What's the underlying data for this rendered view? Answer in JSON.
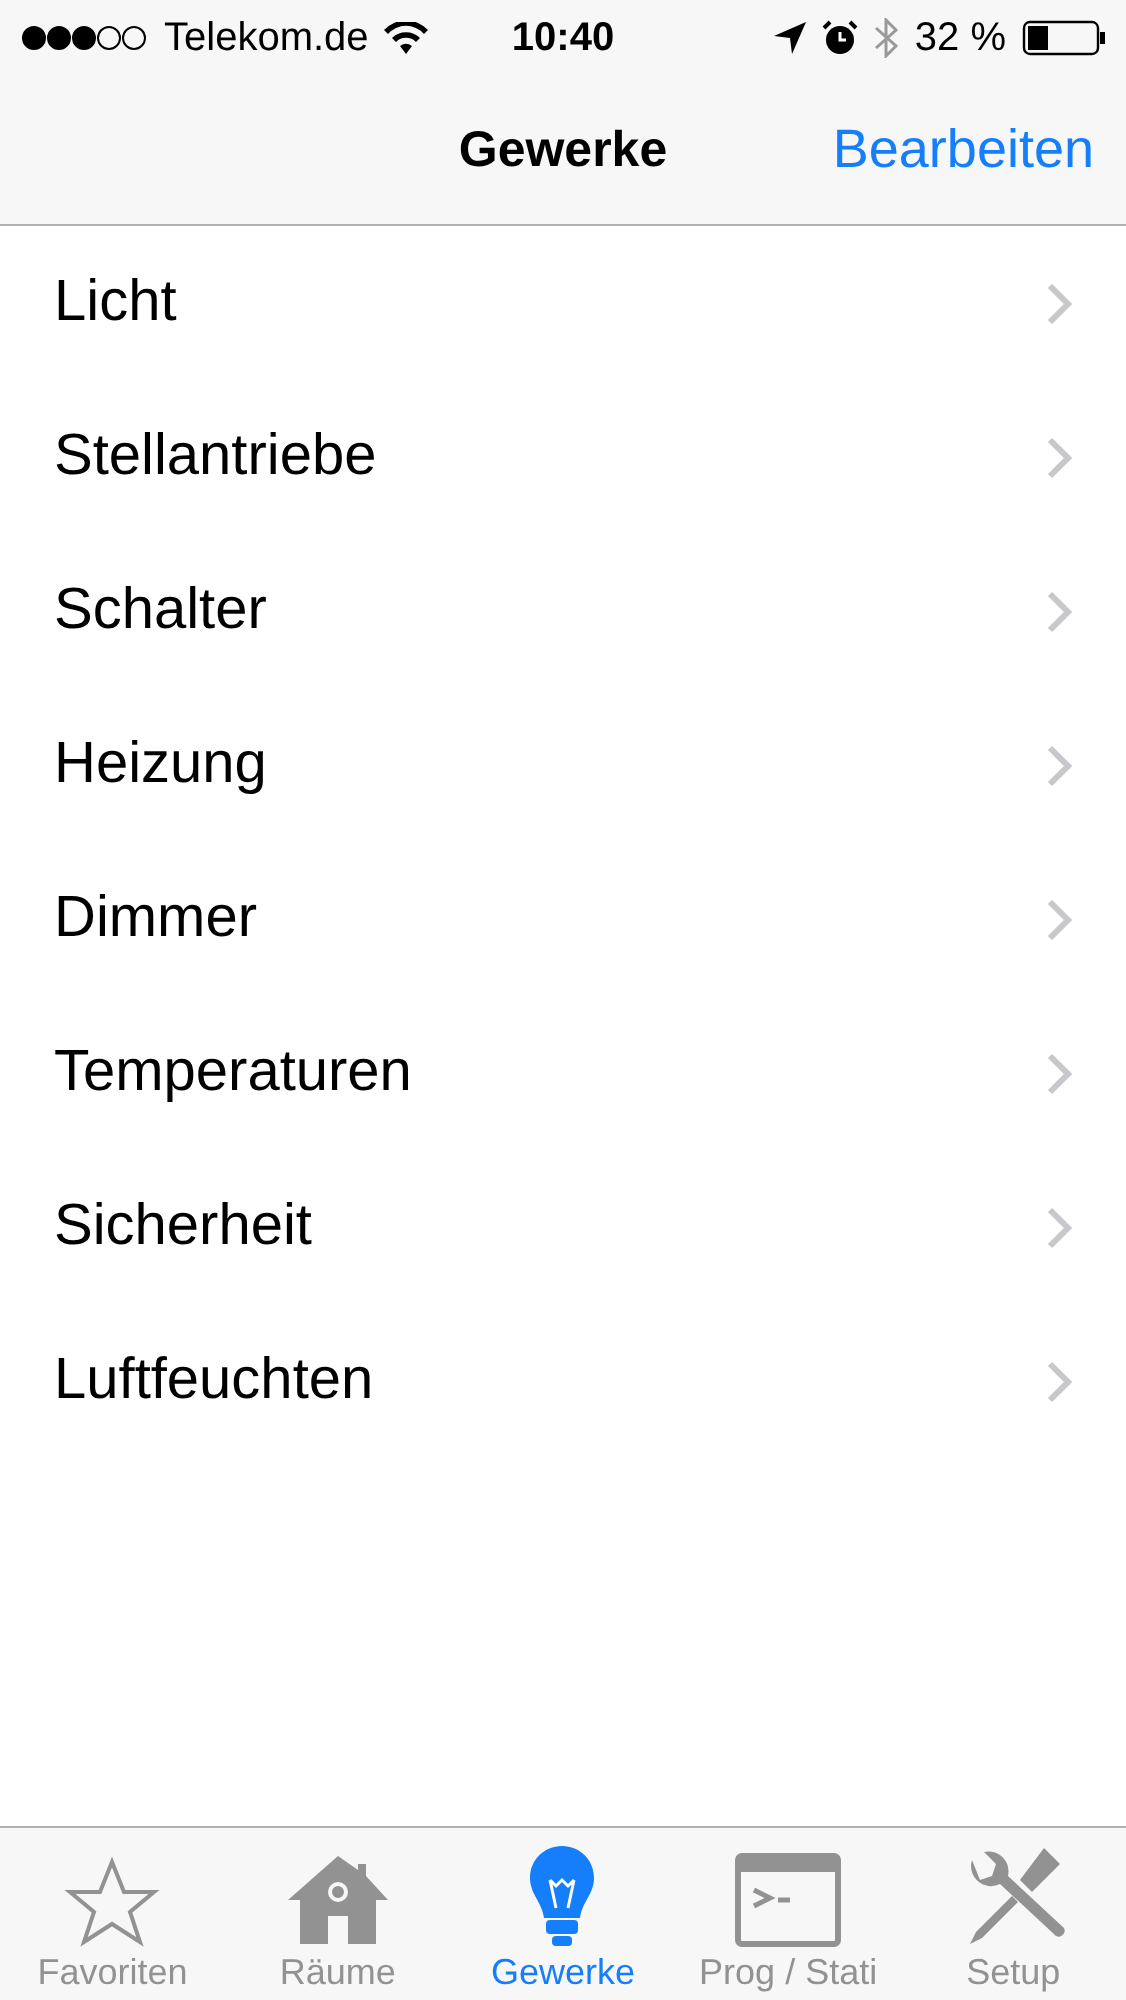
{
  "status_bar": {
    "carrier": "Telekom.de",
    "time": "10:40",
    "battery": "32 %"
  },
  "nav_bar": {
    "title": "Gewerke",
    "edit_button": "Bearbeiten"
  },
  "items": [
    {
      "label": "Licht"
    },
    {
      "label": "Stellantriebe"
    },
    {
      "label": "Schalter"
    },
    {
      "label": "Heizung"
    },
    {
      "label": "Dimmer"
    },
    {
      "label": "Temperaturen"
    },
    {
      "label": "Sicherheit"
    },
    {
      "label": "Luftfeuchten"
    }
  ],
  "tabs": [
    {
      "label": "Favoriten",
      "kind": "star",
      "selected": false
    },
    {
      "label": "Räume",
      "kind": "house",
      "selected": false
    },
    {
      "label": "Gewerke",
      "kind": "bulb",
      "selected": true
    },
    {
      "label": "Prog / Stati",
      "kind": "terminal",
      "selected": false
    },
    {
      "label": "Setup",
      "kind": "tools",
      "selected": false
    }
  ]
}
